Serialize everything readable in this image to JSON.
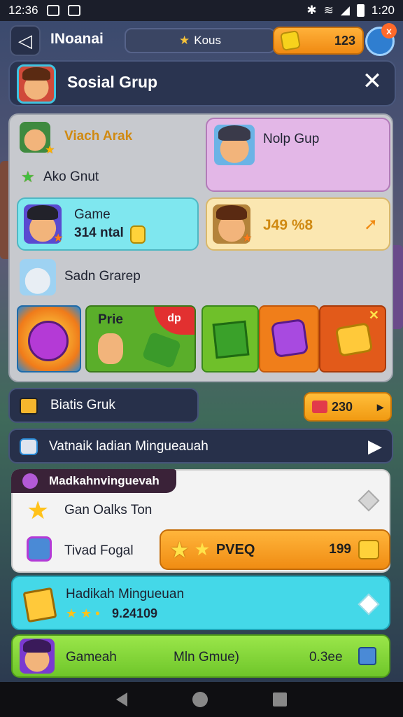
{
  "status_bar": {
    "time_left": "12:36",
    "time_right": "1:20",
    "bluetooth": "✱",
    "wifi": "≋",
    "signal": "◢"
  },
  "top_bar": {
    "back_icon": "◁",
    "title": "INoanai",
    "kouns_label": "Kous",
    "coins": "123",
    "notification_badge": "x"
  },
  "header": {
    "title": "Sosial Grup",
    "close_label": "✕"
  },
  "panel": {
    "friend1_name": "Viach Arak",
    "friend1_status": "Ako Gnut",
    "group_name": "Nolp Gup",
    "card_cyan_title": "Game",
    "card_cyan_sub": "314 ntal",
    "card_cream_value": "J49 %8",
    "friend2_name": "Sadn Grarep",
    "tile_prie_label": "Prie",
    "tile_badge": "dp"
  },
  "status_row": {
    "label": "Biatis Gruk"
  },
  "price_button": {
    "value": "230"
  },
  "nav_row": {
    "label": "Vatnaik ladian Mingueauah"
  },
  "list": {
    "tab_label": "Madkahnvinguevah",
    "item1_label": "Gan Oalks Ton",
    "item2_label": "Tivad Fogal",
    "cta_label": "PVEQ",
    "cta_amount": "199"
  },
  "cyan_strip": {
    "title": "Hadikah Mingueuan",
    "value": "9.24109"
  },
  "green_strip": {
    "left_label": "Gameah",
    "center_label": "Mln Gmue)",
    "value": "0.3ee"
  },
  "colors": {
    "accent_orange": "#f08c13",
    "cyan": "#44d8e8",
    "green": "#8be03e",
    "pink": "#e3b7e7"
  }
}
